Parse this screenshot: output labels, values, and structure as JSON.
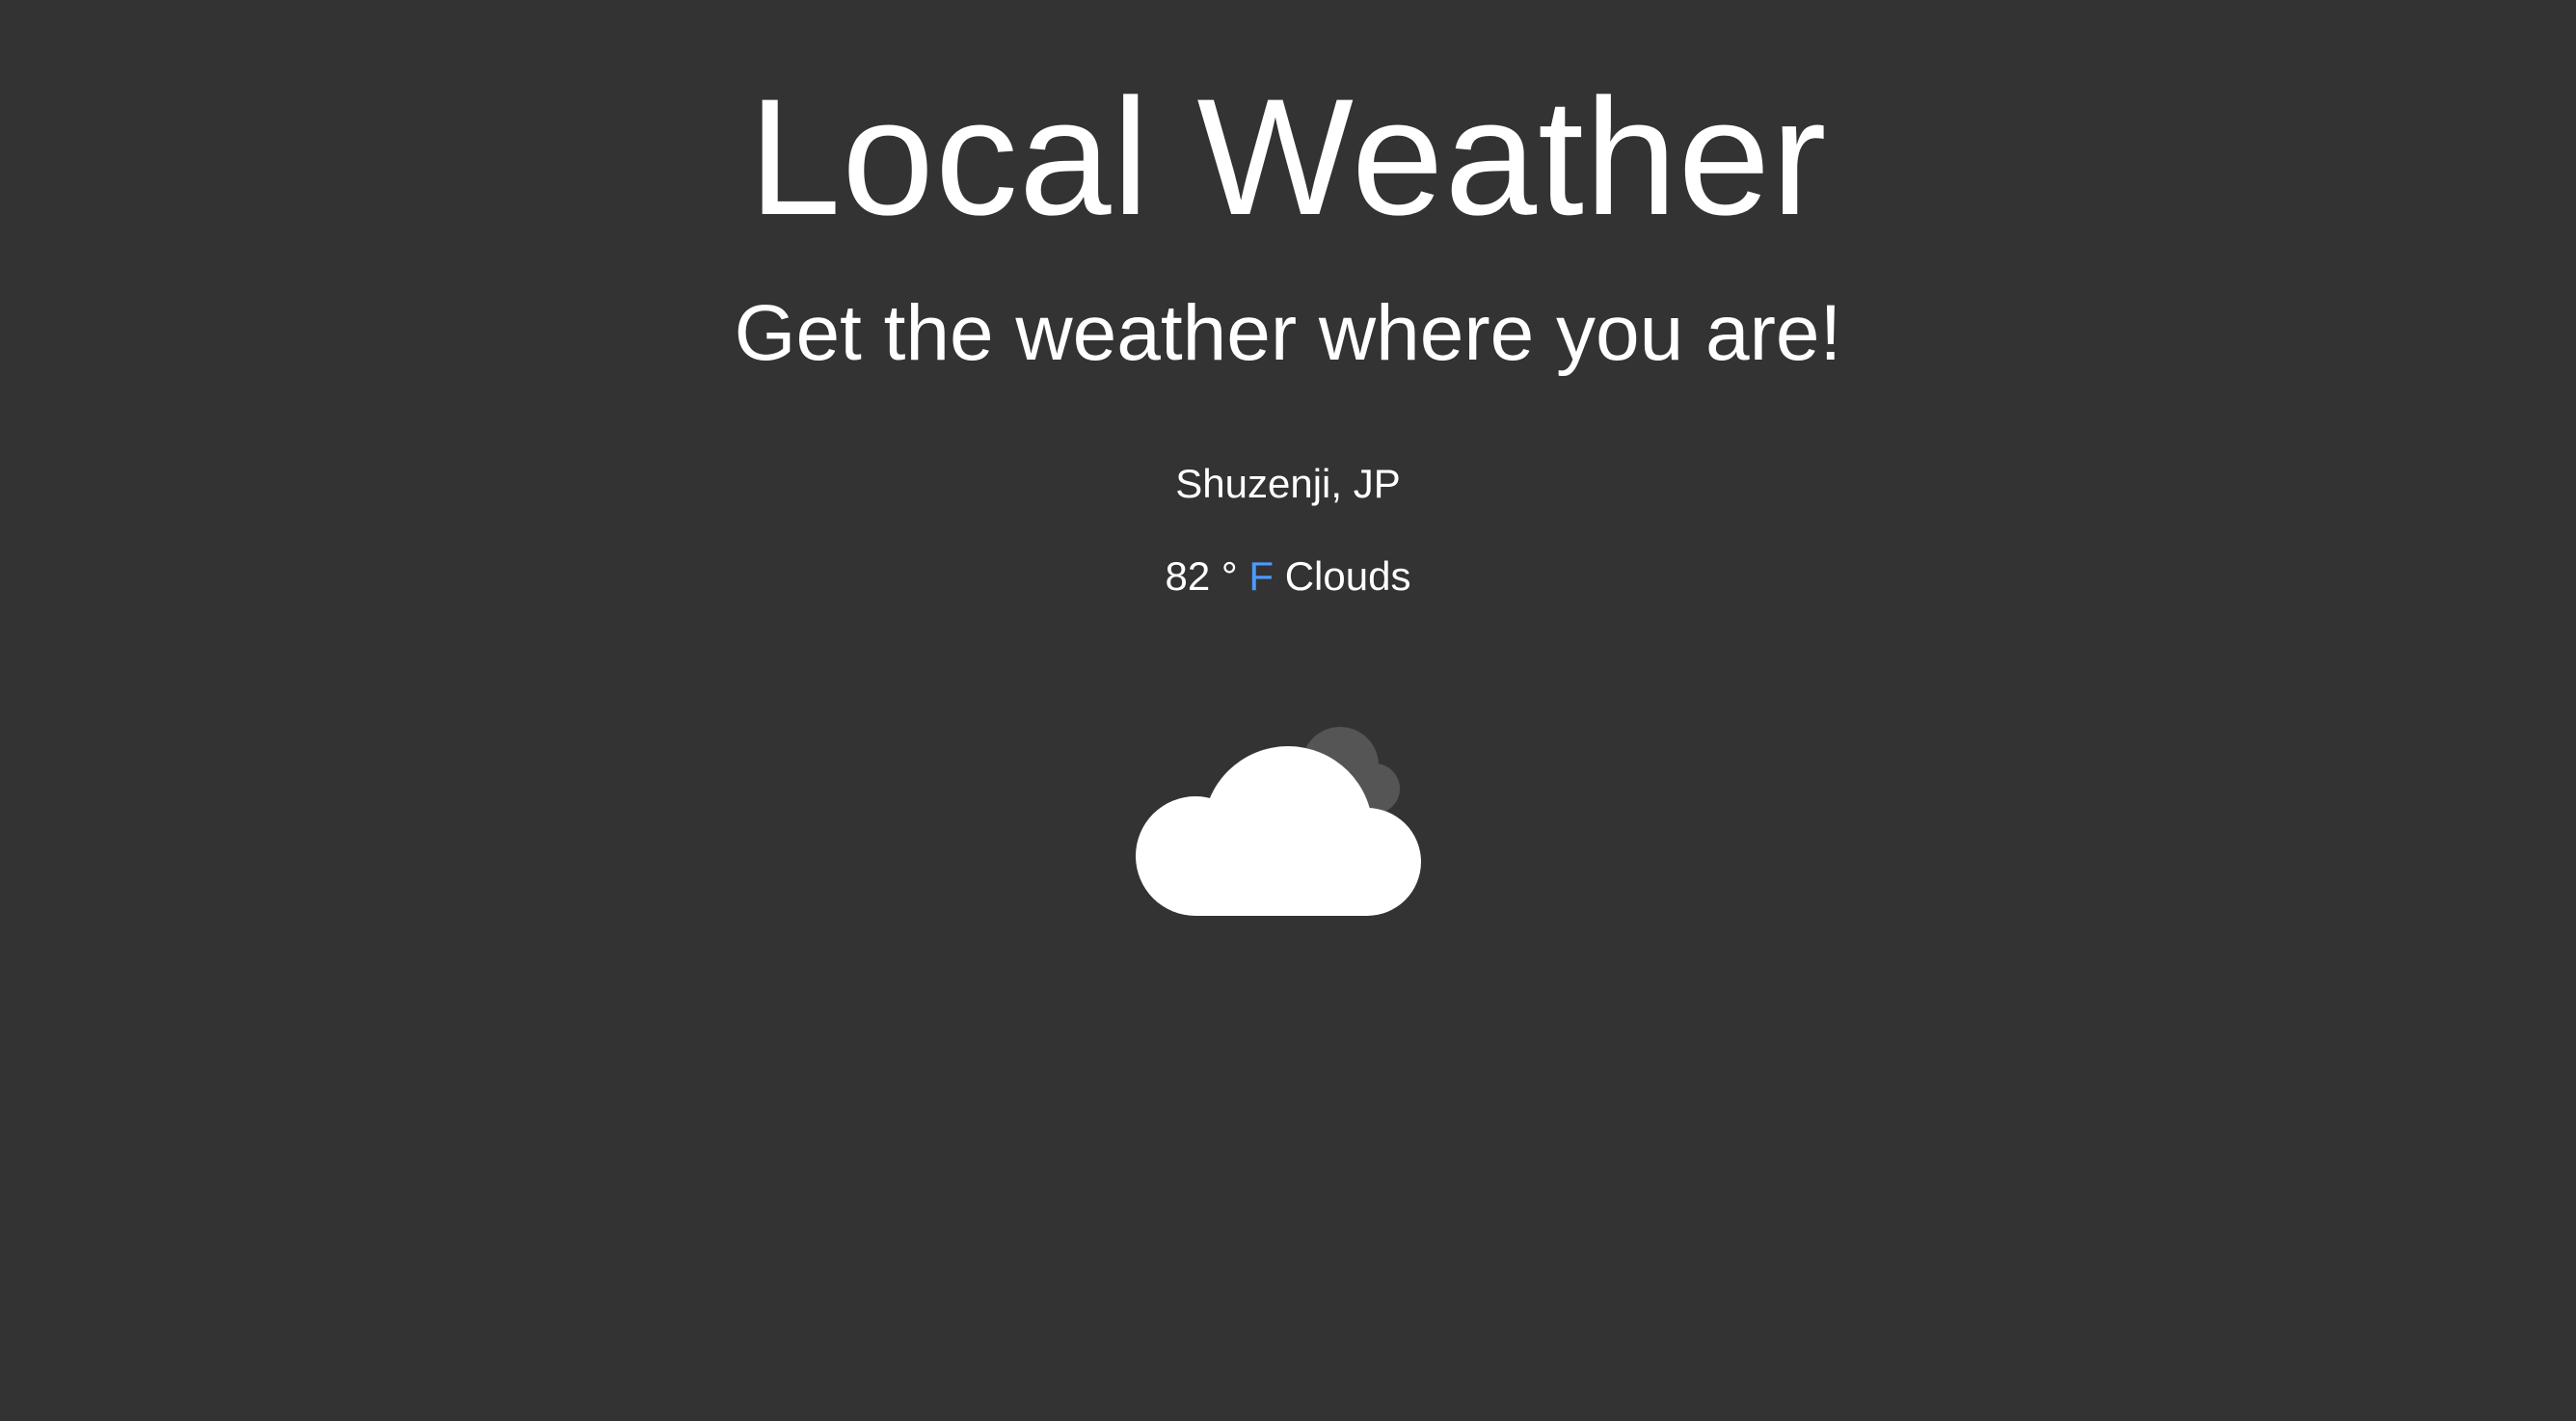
{
  "header": {
    "title": "Local Weather",
    "subtitle": "Get the weather where you are!"
  },
  "weather": {
    "location": "Shuzenji, JP",
    "temperature": "82",
    "degree_symbol": "°",
    "unit": "F",
    "description": "Clouds",
    "icon": "cloud-icon"
  },
  "colors": {
    "background": "#333333",
    "text": "#ffffff",
    "unit_link": "#4b9bff",
    "back_cloud": "#555555"
  }
}
